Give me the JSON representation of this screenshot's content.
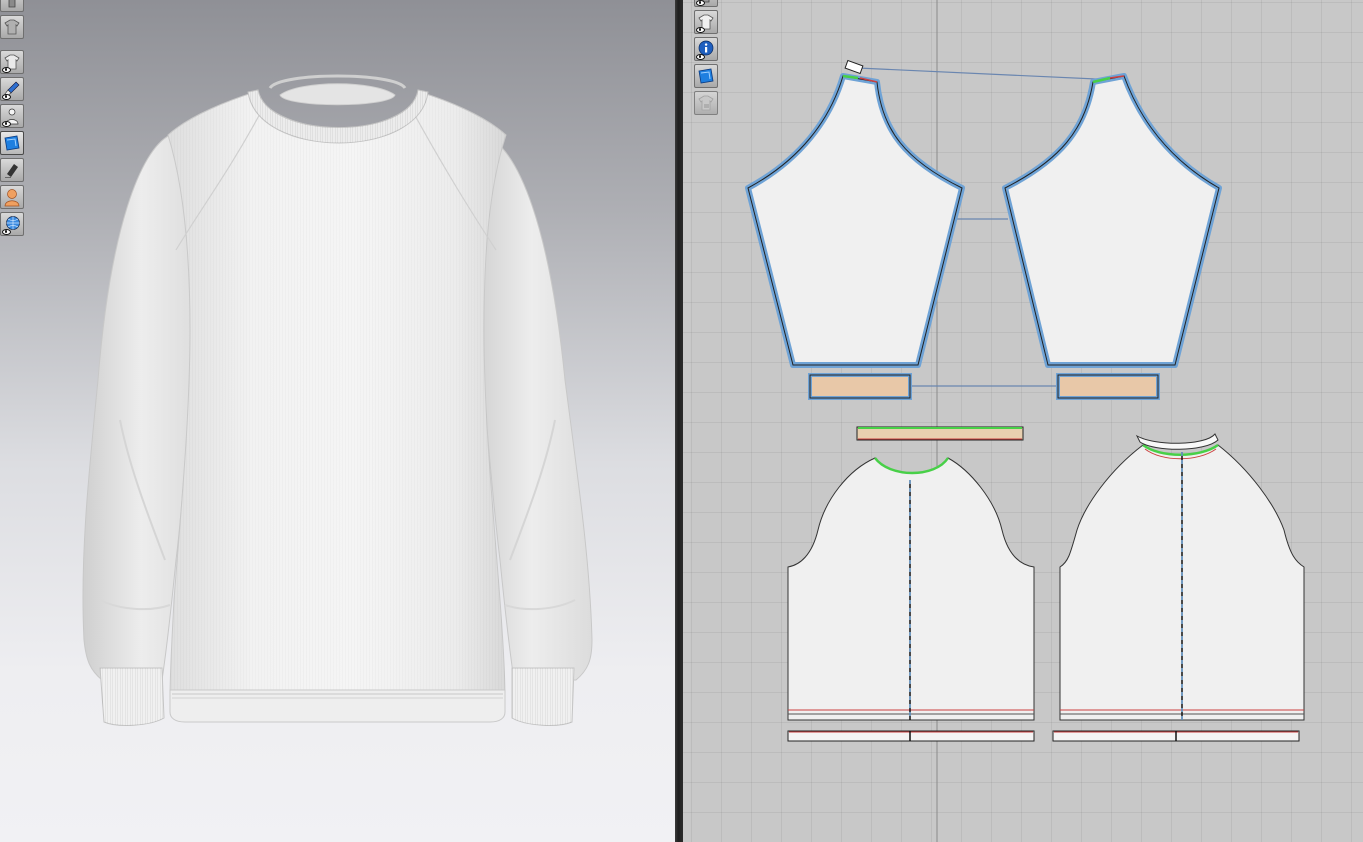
{
  "viewport3d": {
    "toolbar_icons": [
      "garment-display-icon",
      "shirt-gray-icon",
      "garment-eye-icon",
      "brush-eye-icon",
      "avatar-eye-icon",
      "fabric-blue-icon",
      "stamp-icon",
      "avatar-orange-icon",
      "globe-eye-icon"
    ],
    "colors": {
      "garment": "#f2f2f2",
      "background_top": "#8f9096",
      "background_bottom": "#f1f1f4"
    }
  },
  "viewport2d": {
    "toolbar_icons": [
      "top-cut-icon",
      "shirt-eye-icon",
      "info-eye-icon",
      "fabric-texture-icon",
      "locked-shirt-icon"
    ],
    "colors": {
      "grid_bg": "#c8c8c8",
      "selected_outline": "#6fa3d6",
      "cuff_fill": "#e8c8a8",
      "seam_green": "#48d048",
      "seam_red": "#cc4040",
      "piece_fill": "#f0f0f0",
      "grain_line": "#1a3a7a"
    }
  }
}
